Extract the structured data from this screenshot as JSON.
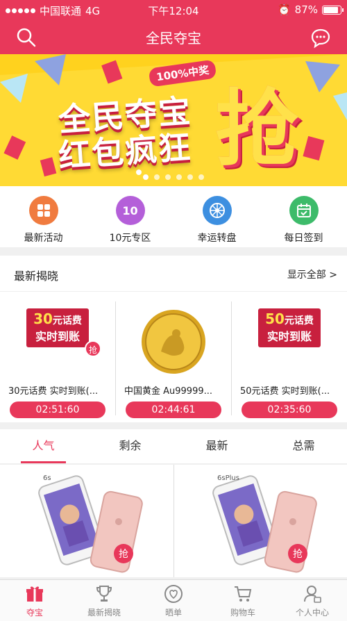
{
  "statusbar": {
    "carrier": "中国联通",
    "network": "4G",
    "time": "下午12:04",
    "battery": "87%"
  },
  "navbar": {
    "title": "全民夺宝"
  },
  "banner": {
    "badge": "100%中奖",
    "line1": "全民夺宝",
    "line2": "红包疯狂",
    "big": "抢",
    "page_count": 6,
    "active_page": 0
  },
  "quick_menu": [
    {
      "label": "最新活动",
      "icon": "grid-icon",
      "color": "#f07b3f"
    },
    {
      "label": "10元专区",
      "icon": "ten-icon",
      "color": "#b45fd9",
      "icon_text": "10"
    },
    {
      "label": "幸运转盘",
      "icon": "wheel-icon",
      "color": "#3d8fe0"
    },
    {
      "label": "每日签到",
      "icon": "calendar-check-icon",
      "color": "#3dbb6a"
    }
  ],
  "reveal": {
    "title": "最新揭晓",
    "more": "显示全部 >",
    "items": [
      {
        "name": "30元话费 实时到账(...",
        "timer": "02:51:60",
        "amount": "30",
        "amount_unit": "元话费",
        "tag": "实时到账",
        "grab": "抢"
      },
      {
        "name": "中国黄金 Au99999...",
        "timer": "02:44:61"
      },
      {
        "name": "50元话费 实时到账(...",
        "timer": "02:35:60",
        "amount": "50",
        "amount_unit": "元话费",
        "tag": "实时到账"
      }
    ]
  },
  "tabs": [
    {
      "label": "人气",
      "active": true
    },
    {
      "label": "剩余",
      "active": false
    },
    {
      "label": "最新",
      "active": false
    },
    {
      "label": "总需",
      "active": false
    }
  ],
  "products": [
    {
      "model": "6s",
      "grab": "抢"
    },
    {
      "model": "6sPlus",
      "grab": "抢"
    }
  ],
  "bottom_nav": [
    {
      "label": "夺宝",
      "icon": "gift-icon",
      "active": true
    },
    {
      "label": "最新揭晓",
      "icon": "trophy-icon",
      "active": false
    },
    {
      "label": "晒单",
      "icon": "heart-icon",
      "active": false
    },
    {
      "label": "购物车",
      "icon": "cart-icon",
      "active": false
    },
    {
      "label": "个人中心",
      "icon": "user-icon",
      "active": false
    }
  ]
}
